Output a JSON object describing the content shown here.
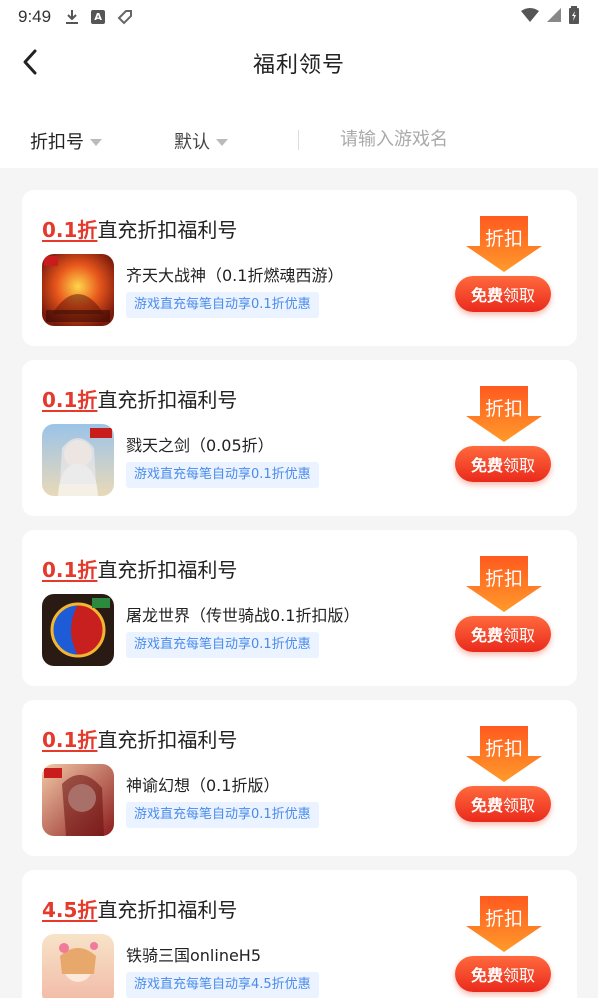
{
  "status_bar": {
    "time": "9:49",
    "a_icon_letter": "A"
  },
  "header": {
    "title": "福利领号"
  },
  "filters": {
    "discount_label": "折扣号",
    "sort_label": "默认",
    "search_placeholder": "请输入游戏名"
  },
  "cards": [
    {
      "discount": "0.1折",
      "title_suffix": "直充折扣福利号",
      "game": "齐天大战神（0.1折燃魂西游）",
      "tag": "游戏直充每笔自动享0.1折优惠",
      "badge": "折扣",
      "btn_bold": "免费",
      "btn_rest": "领取",
      "icon": "game-icon-qitian"
    },
    {
      "discount": "0.1折",
      "title_suffix": "直充折扣福利号",
      "game": "戮天之剑（0.05折）",
      "tag": "游戏直充每笔自动享0.1折优惠",
      "badge": "折扣",
      "btn_bold": "免费",
      "btn_rest": "领取",
      "icon": "game-icon-lutian"
    },
    {
      "discount": "0.1折",
      "title_suffix": "直充折扣福利号",
      "game": "屠龙世界（传世骑战0.1折扣版）",
      "tag": "游戏直充每笔自动享0.1折优惠",
      "badge": "折扣",
      "btn_bold": "免费",
      "btn_rest": "领取",
      "icon": "game-icon-tulong"
    },
    {
      "discount": "0.1折",
      "title_suffix": "直充折扣福利号",
      "game": "神谕幻想（0.1折版）",
      "tag": "游戏直充每笔自动享0.1折优惠",
      "badge": "折扣",
      "btn_bold": "免费",
      "btn_rest": "领取",
      "icon": "game-icon-shenyu"
    },
    {
      "discount": "4.5折",
      "title_suffix": "直充折扣福利号",
      "game": "铁骑三国onlineH5",
      "tag": "游戏直充每笔自动享4.5折优惠",
      "badge": "折扣",
      "btn_bold": "免费",
      "btn_rest": "领取",
      "icon": "game-icon-tieqi"
    }
  ],
  "colors": {
    "accent": "#e4392b",
    "tag_text": "#4a8bea",
    "tag_bg": "#eaf3ff",
    "badge_orange": "#ff7a1a"
  }
}
